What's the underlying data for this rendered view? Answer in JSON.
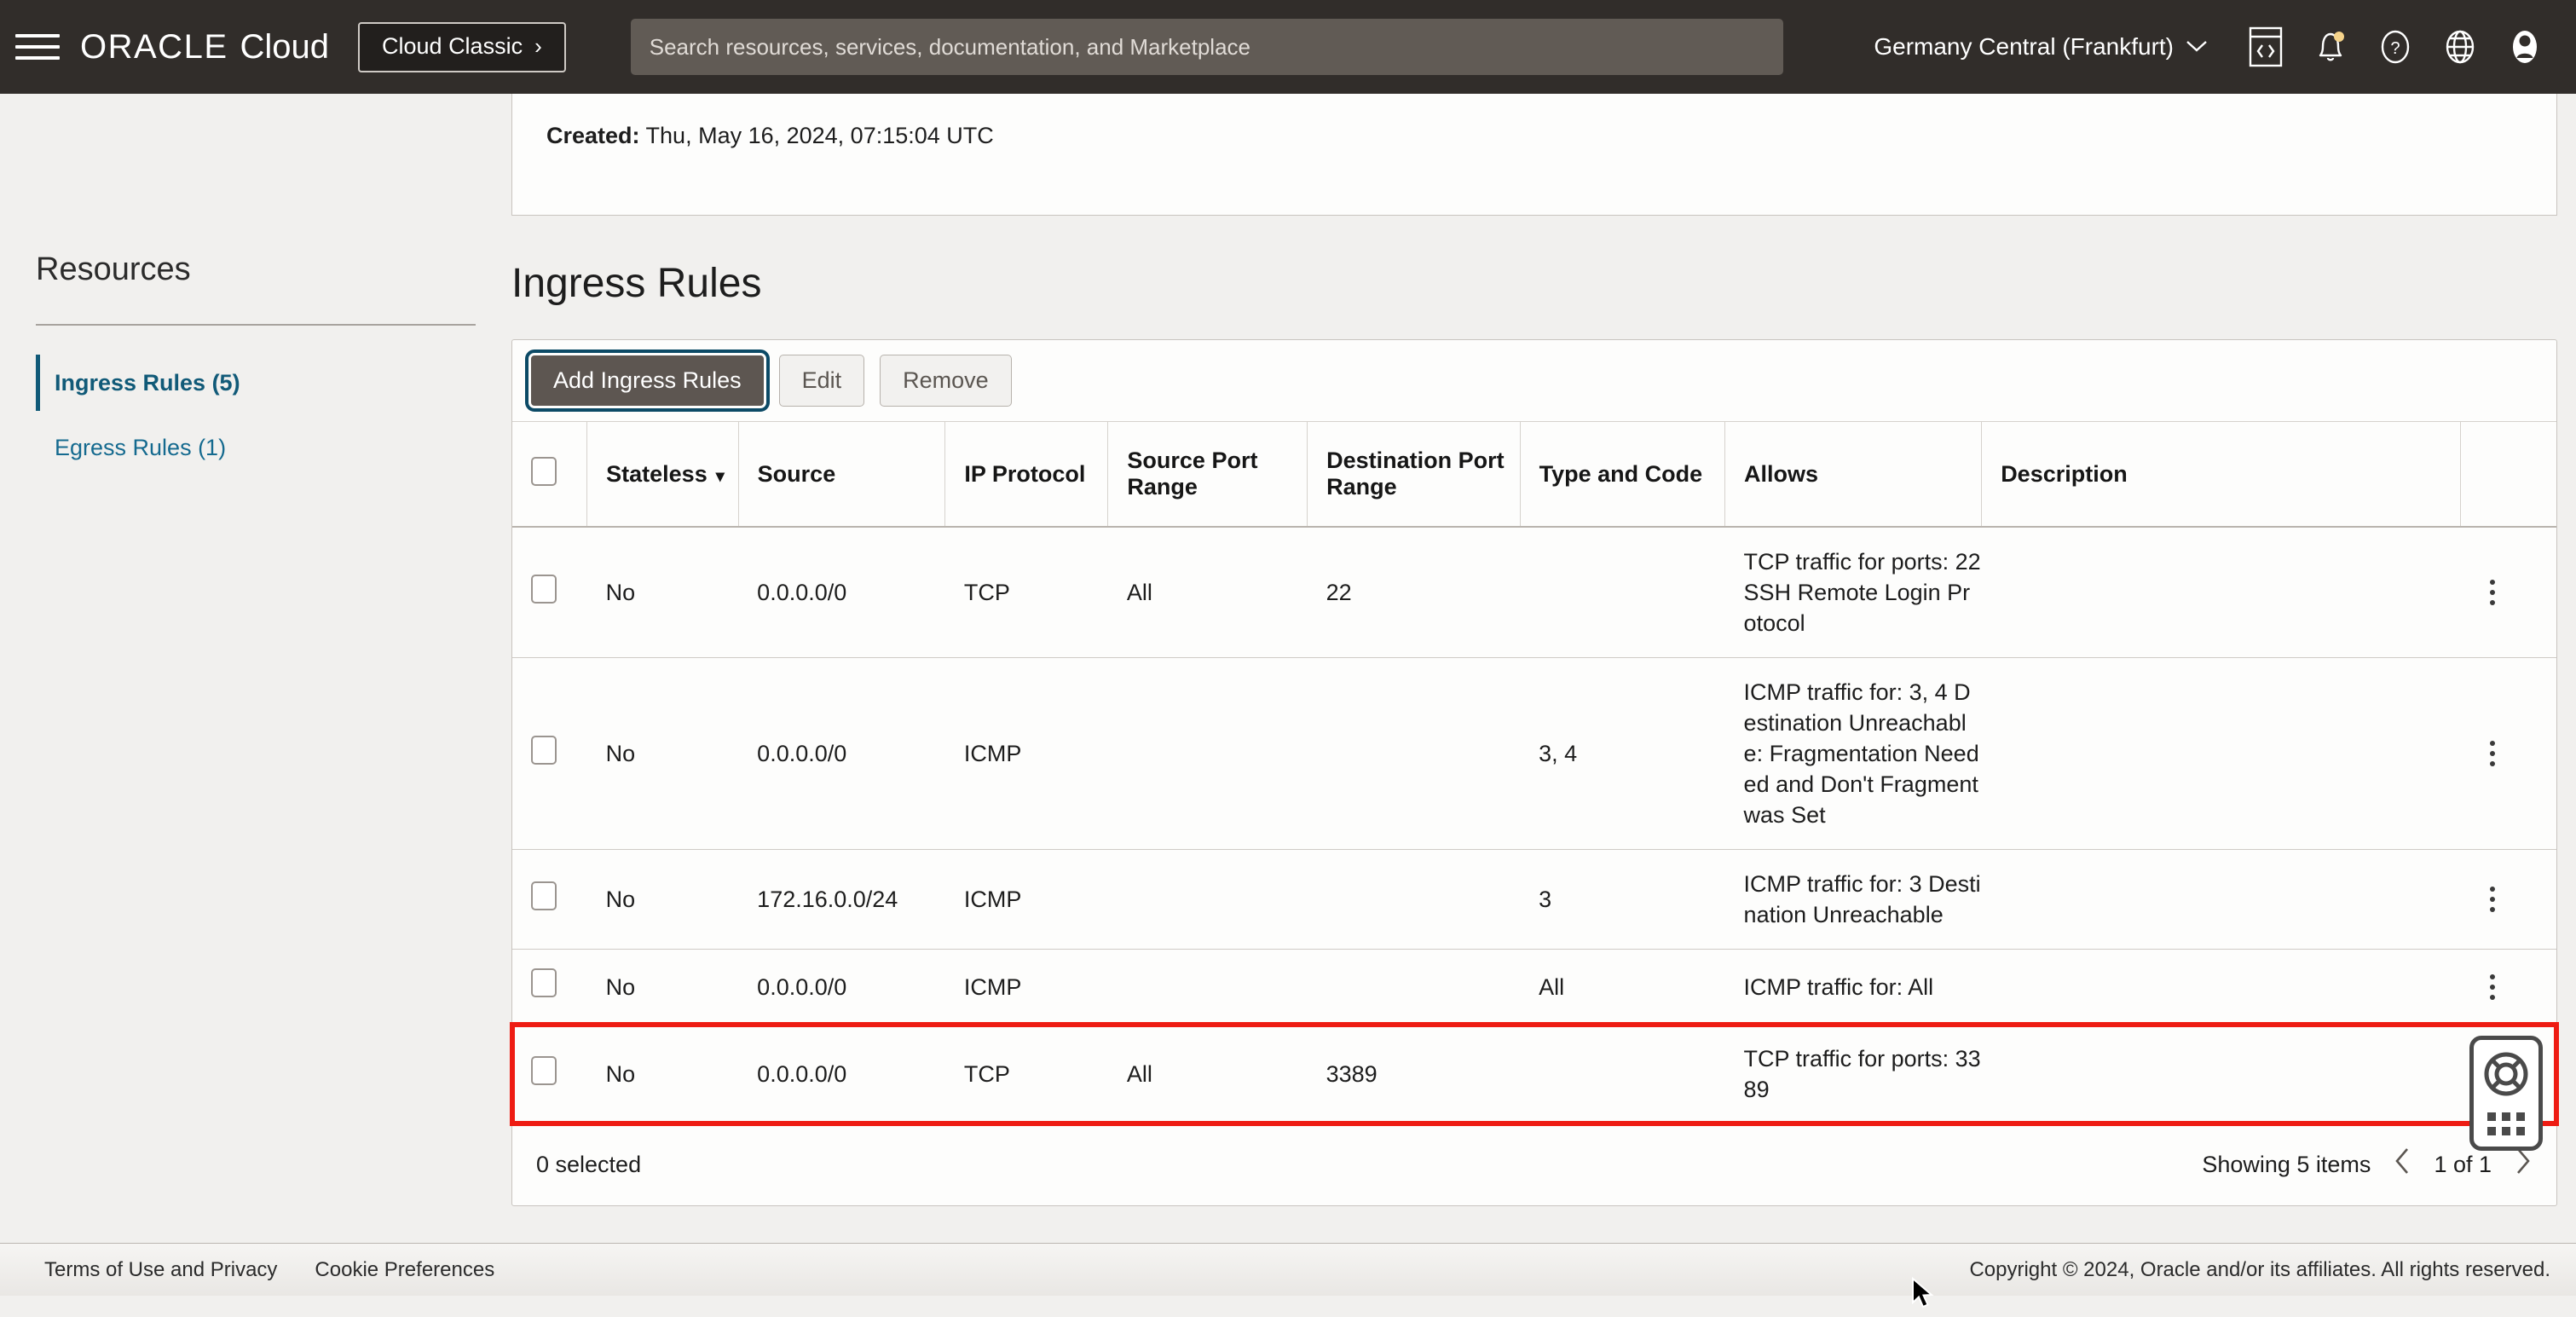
{
  "topnav": {
    "menu_icon": "hamburger-icon",
    "brand_oracle": "ORACLE",
    "brand_cloud": "Cloud",
    "cloud_classic_label": "Cloud Classic",
    "cloud_classic_chevron": "›",
    "search_placeholder": "Search resources, services, documentation, and Marketplace",
    "search_value": "",
    "region": "Germany Central (Frankfurt)",
    "region_chevron": "∨",
    "icons": [
      "code-editor-icon",
      "notifications-bell-icon",
      "help-question-icon",
      "language-globe-icon",
      "user-avatar-icon"
    ],
    "bg_color": "#312d2a",
    "notification_dot_color": "#f5d38a"
  },
  "sidebar": {
    "title": "Resources",
    "items": [
      {
        "label": "Ingress Rules (5)",
        "active": true
      },
      {
        "label": "Egress Rules (1)",
        "active": false
      }
    ],
    "accent_color": "#115a78"
  },
  "details": {
    "created_label": "Created:",
    "created_value": "Thu, May 16, 2024, 07:15:04 UTC"
  },
  "main": {
    "section_title": "Ingress Rules",
    "toolbar": {
      "add_label": "Add Ingress Rules",
      "edit_label": "Edit",
      "remove_label": "Remove",
      "primary_bg": "#5d5651",
      "focus_ring": "#0c4a66"
    },
    "table": {
      "select_all_checkbox": "",
      "columns": [
        "Stateless",
        "Source",
        "IP Protocol",
        "Source Port Range",
        "Destination Port Range",
        "Type and Code",
        "Allows",
        "Description"
      ],
      "sort_column": "Stateless",
      "sort_caret": "▾",
      "rows": [
        {
          "stateless": "No",
          "source": "0.0.0.0/0",
          "ip_protocol": "TCP",
          "source_port_range": "All",
          "destination_port_range": "22",
          "type_and_code": "",
          "allows": "TCP traffic for ports: 22 SSH Remote Login Protocol",
          "description": "",
          "highlighted": false
        },
        {
          "stateless": "No",
          "source": "0.0.0.0/0",
          "ip_protocol": "ICMP",
          "source_port_range": "",
          "destination_port_range": "",
          "type_and_code": "3, 4",
          "allows": "ICMP traffic for: 3, 4 Destination Unreachable: Fragmentation Needed and Don't Fragment was Set",
          "description": "",
          "highlighted": false
        },
        {
          "stateless": "No",
          "source": "172.16.0.0/24",
          "ip_protocol": "ICMP",
          "source_port_range": "",
          "destination_port_range": "",
          "type_and_code": "3",
          "allows": "ICMP traffic for: 3 Destination Unreachable",
          "description": "",
          "highlighted": false
        },
        {
          "stateless": "No",
          "source": "0.0.0.0/0",
          "ip_protocol": "ICMP",
          "source_port_range": "",
          "destination_port_range": "",
          "type_and_code": "All",
          "allows": "ICMP traffic for: All",
          "description": "",
          "highlighted": false
        },
        {
          "stateless": "No",
          "source": "0.0.0.0/0",
          "ip_protocol": "TCP",
          "source_port_range": "All",
          "destination_port_range": "3389",
          "type_and_code": "",
          "allows": "TCP traffic for ports: 3389",
          "description": "",
          "highlighted": true
        }
      ],
      "highlight_color": "#ee1c13",
      "footer": {
        "selected_text": "0 selected",
        "showing_text": "Showing 5 items",
        "prev_arrow": "‹",
        "page_text": "1 of 1",
        "next_arrow": "›"
      }
    }
  },
  "help_widget": {
    "icon": "life-ring-icon",
    "handle": "drag-handle-dots"
  },
  "footer": {
    "links": [
      "Terms of Use and Privacy",
      "Cookie Preferences"
    ],
    "copyright": "Copyright © 2024, Oracle and/or its affiliates. All rights reserved."
  }
}
